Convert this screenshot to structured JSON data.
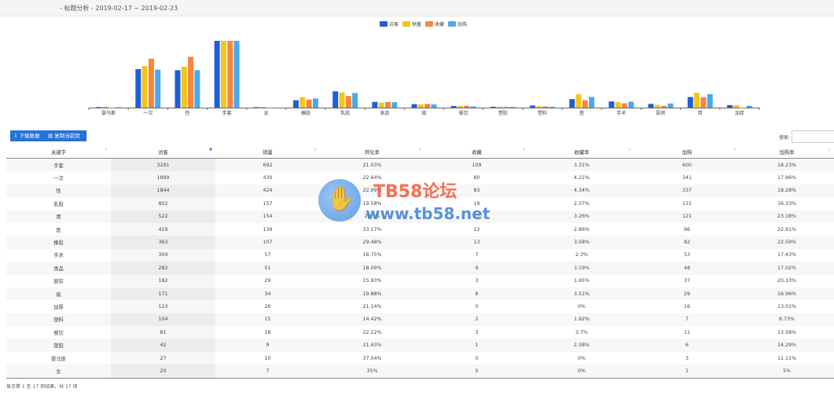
{
  "header": {
    "title": "- 标题分析 - 2019-02-17 ~ 2019-02-23"
  },
  "chart_data": {
    "type": "bar",
    "categories": [
      "婴马斯",
      "一次",
      "性",
      "手套",
      "女",
      "橡胶",
      "乳胶",
      "食品",
      "级",
      "餐饮",
      "塑胶",
      "塑料",
      "医",
      "手术",
      "厨房",
      "用",
      "加厚"
    ],
    "series": [
      {
        "name": "访客",
        "color": "#1f5fd6",
        "values": [
          27,
          1899,
          1844,
          3291,
          20,
          363,
          802,
          282,
          171,
          81,
          42,
          104,
          419,
          304,
          182,
          522,
          123
        ]
      },
      {
        "name": "销量",
        "color": "#f5c518",
        "values": [
          10,
          430,
          424,
          692,
          7,
          107,
          157,
          51,
          34,
          18,
          9,
          15,
          139,
          57,
          29,
          154,
          26
        ]
      },
      {
        "name": "收藏",
        "color": "#f5883a",
        "values": [
          0,
          80,
          83,
          109,
          0,
          13,
          19,
          9,
          6,
          3,
          1,
          2,
          12,
          7,
          3,
          17,
          0
        ]
      },
      {
        "name": "加购",
        "color": "#4aa8ee",
        "values": [
          3,
          341,
          337,
          600,
          1,
          82,
          131,
          48,
          29,
          11,
          6,
          7,
          96,
          53,
          37,
          121,
          16
        ]
      }
    ],
    "legend": "top-center",
    "grid": false,
    "note_scale": "series drawn on independent scales"
  },
  "toolbar": {
    "download_label": "下载数据",
    "copy_label": "复制当前页",
    "download_icon": "⇩",
    "copy_icon": "▤"
  },
  "search": {
    "label": "搜索:",
    "placeholder": ""
  },
  "table": {
    "columns": [
      "关键字",
      "访客",
      "销量",
      "转化率",
      "收藏",
      "收藏率",
      "加购",
      "加购率"
    ],
    "sorted_column": "访客",
    "rows": [
      [
        "手套",
        "3291",
        "692",
        "21.03%",
        "109",
        "3.31%",
        "600",
        "18.23%"
      ],
      [
        "一次",
        "1899",
        "430",
        "22.64%",
        "80",
        "4.21%",
        "341",
        "17.96%"
      ],
      [
        "性",
        "1844",
        "424",
        "22.99%",
        "83",
        "4.34%",
        "337",
        "18.28%"
      ],
      [
        "乳胶",
        "802",
        "157",
        "19.58%",
        "19",
        "2.37%",
        "131",
        "16.33%"
      ],
      [
        "用",
        "522",
        "154",
        "29.5%",
        "17",
        "3.26%",
        "121",
        "23.18%"
      ],
      [
        "医",
        "419",
        "139",
        "33.17%",
        "12",
        "2.86%",
        "96",
        "22.91%"
      ],
      [
        "橡胶",
        "363",
        "107",
        "29.48%",
        "13",
        "3.58%",
        "82",
        "22.59%"
      ],
      [
        "手术",
        "304",
        "57",
        "18.75%",
        "7",
        "2.3%",
        "53",
        "17.43%"
      ],
      [
        "食品",
        "282",
        "51",
        "18.09%",
        "9",
        "3.19%",
        "48",
        "17.02%"
      ],
      [
        "厨房",
        "182",
        "29",
        "15.93%",
        "3",
        "1.65%",
        "37",
        "20.33%"
      ],
      [
        "级",
        "171",
        "34",
        "19.88%",
        "6",
        "3.51%",
        "29",
        "16.96%"
      ],
      [
        "加厚",
        "123",
        "26",
        "21.14%",
        "0",
        "0%",
        "16",
        "13.01%"
      ],
      [
        "塑料",
        "104",
        "15",
        "14.42%",
        "2",
        "1.92%",
        "7",
        "6.73%"
      ],
      [
        "餐饮",
        "81",
        "18",
        "22.22%",
        "3",
        "3.7%",
        "11",
        "13.58%"
      ],
      [
        "塑胶",
        "42",
        "9",
        "21.43%",
        "1",
        "2.38%",
        "6",
        "14.29%"
      ],
      [
        "婴马斯",
        "27",
        "10",
        "37.04%",
        "0",
        "0%",
        "3",
        "11.11%"
      ],
      [
        "女",
        "20",
        "7",
        "35%",
        "0",
        "0%",
        "1",
        "5%"
      ]
    ]
  },
  "footer": {
    "info": "显示第 1 至 17 项结果，共 17 项"
  },
  "watermark": {
    "title": "TB58论坛",
    "url": "www.tb58.net",
    "hand": "✋"
  }
}
